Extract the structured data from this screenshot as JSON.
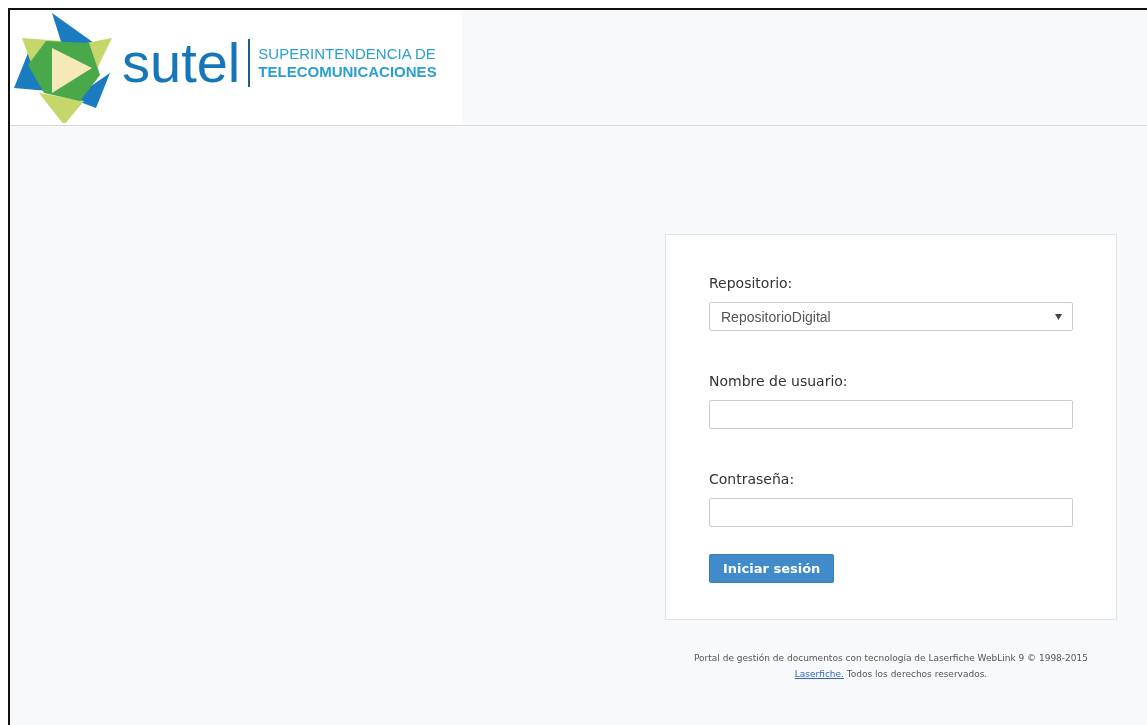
{
  "header": {
    "logo": {
      "wordmark": "sutel",
      "tagline_1": "SUPERINTENDENCIA DE",
      "tagline_2": "TELECOMUNICACIONES"
    }
  },
  "login": {
    "fields": [
      {
        "kind": "select",
        "label": "Repositorio:",
        "value": "RepositorioDigital"
      },
      {
        "kind": "text",
        "label": "Nombre de usuario:"
      },
      {
        "kind": "password",
        "label": "Contraseña:"
      }
    ],
    "button": "Iniciar sesión"
  },
  "footer": {
    "text_before": "Portal de gestión de documentos con tecnología de Laserfiche WebLink 9 © 1998-2015",
    "link": "Laserfiche.",
    "text_after": "Todos los derechos reservados."
  }
}
